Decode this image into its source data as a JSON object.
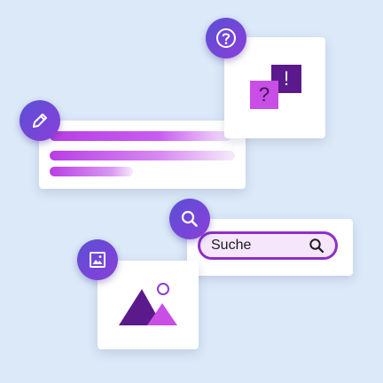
{
  "search": {
    "value": "Suche"
  },
  "qa_graphic": {
    "question_glyph": "?",
    "exclamation_glyph": "!"
  },
  "icons": [
    "help-circle-icon",
    "pencil-icon",
    "search-icon",
    "image-icon",
    "landscape-icon"
  ],
  "colors": {
    "background": "#dbe9f8",
    "badge_start": "#5a4fd6",
    "badge_end": "#8a3fd8",
    "accent_magenta": "#c84ee6",
    "accent_purple": "#5b1a8c",
    "search_border": "#8f2fc7"
  }
}
